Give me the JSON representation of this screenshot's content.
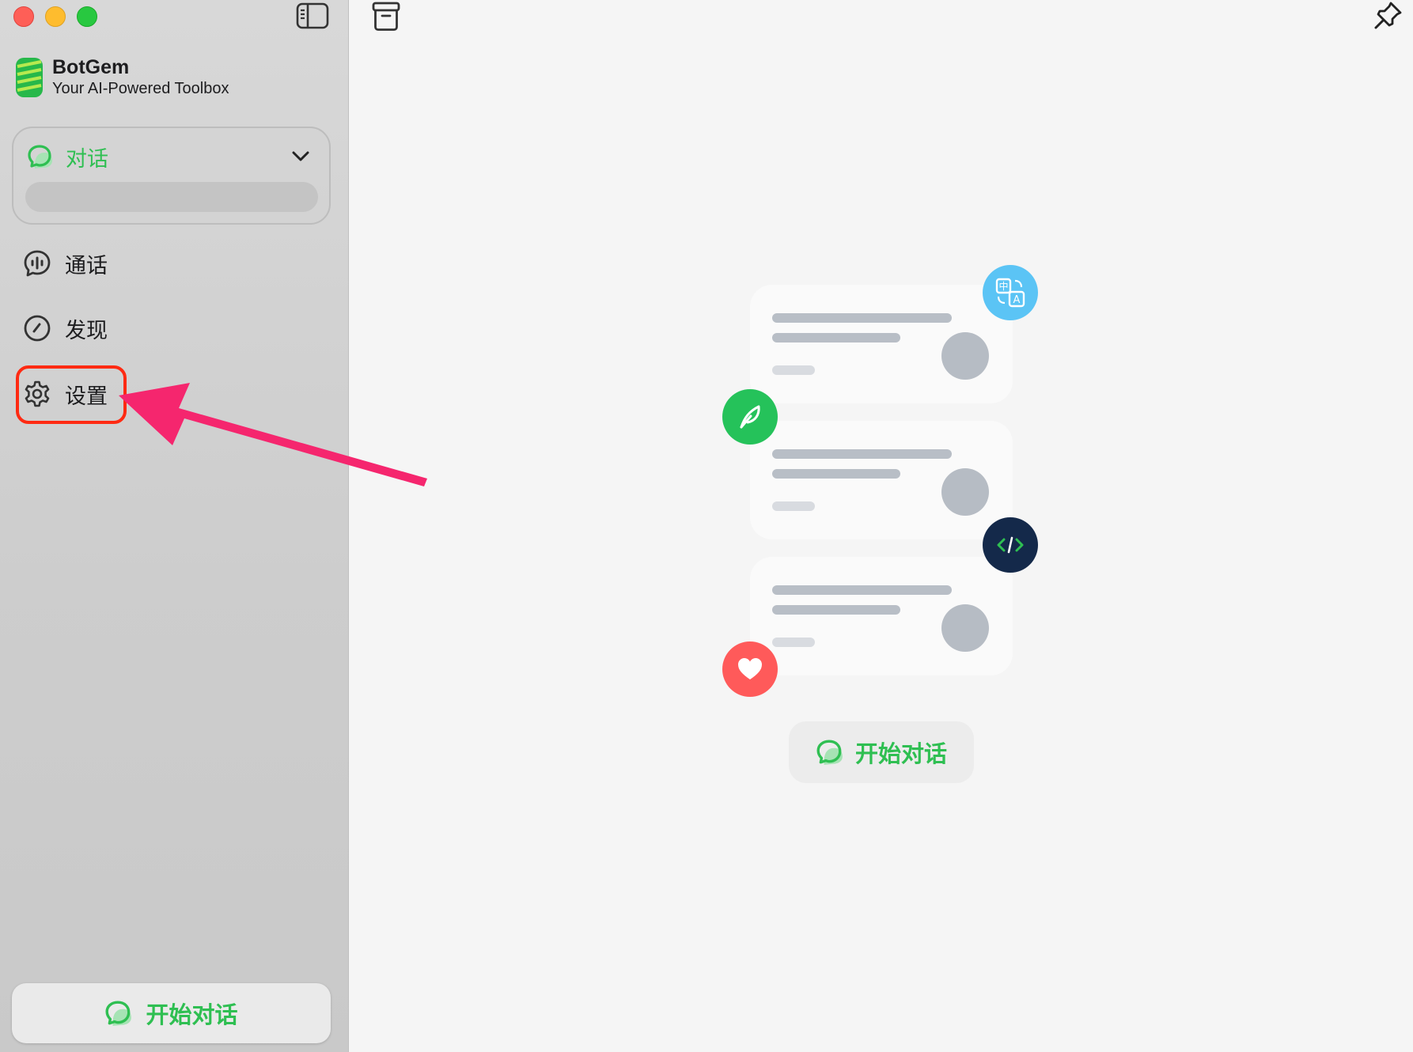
{
  "brand": {
    "name": "BotGem",
    "tagline": "Your AI-Powered Toolbox"
  },
  "sidebar": {
    "chat_section": {
      "label": "对话"
    },
    "items": [
      {
        "label": "通话",
        "icon": "voice-call-icon"
      },
      {
        "label": "发现",
        "icon": "compass-icon"
      },
      {
        "label": "设置",
        "icon": "gear-icon"
      }
    ],
    "start_button": {
      "label": "开始对话"
    }
  },
  "main": {
    "start_button": {
      "label": "开始对话"
    }
  },
  "colors": {
    "accent_green": "#2fbf52",
    "highlight_red": "#ff2a12",
    "arrow_pink": "#f5266e",
    "translate_blue": "#5bc4f5",
    "code_navy": "#14294a",
    "heart_red": "#ff5a5a"
  }
}
